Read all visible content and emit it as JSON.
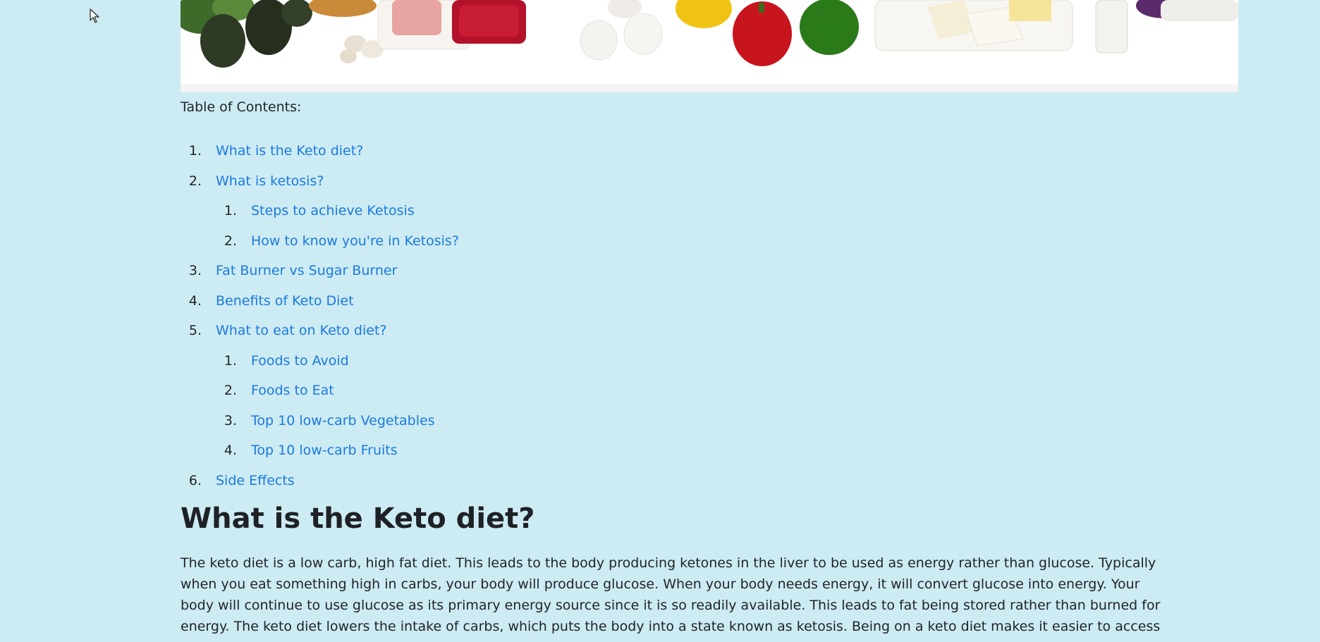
{
  "toc": {
    "title": "Table of Contents:",
    "items": [
      {
        "num": "1.",
        "label": "What is the Keto diet?"
      },
      {
        "num": "2.",
        "label": "What is ketosis?",
        "children": [
          {
            "num": "1.",
            "label": "Steps to achieve Ketosis"
          },
          {
            "num": "2.",
            "label": "How to know you're in Ketosis?"
          }
        ]
      },
      {
        "num": "3.",
        "label": "Fat Burner vs Sugar Burner"
      },
      {
        "num": "4.",
        "label": "Benefits of Keto Diet"
      },
      {
        "num": "5.",
        "label": "What to eat on Keto diet?",
        "children": [
          {
            "num": "1.",
            "label": "Foods to Avoid"
          },
          {
            "num": "2.",
            "label": "Foods to Eat"
          },
          {
            "num": "3.",
            "label": "Top 10 low-carb Vegetables"
          },
          {
            "num": "4.",
            "label": "Top 10 low-carb Fruits"
          }
        ]
      },
      {
        "num": "6.",
        "label": "Side Effects"
      }
    ]
  },
  "section": {
    "title": "What is the Keto diet?",
    "paragraph": "The keto diet is a low carb, high fat diet. This leads to the body producing ketones in the liver to be used as energy rather than glucose. Typically when you eat something high in carbs, your body will produce glucose. When your body needs energy, it will convert glucose into energy. Your body will continue to use glucose as its primary energy source since it is so readily available. This leads to fat being stored rather than burned for energy. The keto diet lowers the intake of carbs, which puts the body into a state known as ketosis. Being on a keto diet makes it easier to access stored fat to burn it off."
  },
  "colors": {
    "background": "#cdebf3",
    "link": "#1a7ae0",
    "text": "#212529"
  }
}
